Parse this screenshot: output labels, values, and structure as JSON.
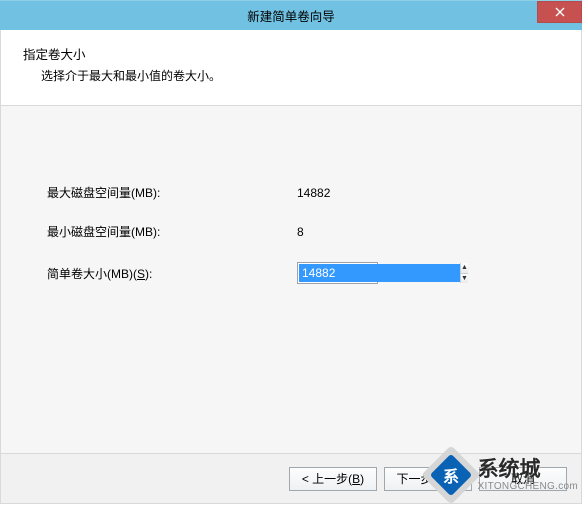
{
  "titlebar": {
    "title": "新建简单卷向导"
  },
  "header": {
    "title": "指定卷大小",
    "subtitle": "选择介于最大和最小值的卷大小。"
  },
  "fields": {
    "max_label": "最大磁盘空间量(MB):",
    "max_value": "14882",
    "min_label": "最小磁盘空间量(MB):",
    "min_value": "8",
    "size_label_pre": "简单卷大小(MB)(",
    "size_label_key": "S",
    "size_label_post": "):",
    "size_value": "14882"
  },
  "buttons": {
    "back_pre": "< 上一步(",
    "back_key": "B",
    "back_post": ")",
    "next_pre": "下一步(",
    "next_key": "N",
    "next_post": ") >",
    "cancel": "取消"
  },
  "watermark": {
    "badge": "系",
    "cn": "系统城",
    "en": "XITONGCHENG.com"
  }
}
